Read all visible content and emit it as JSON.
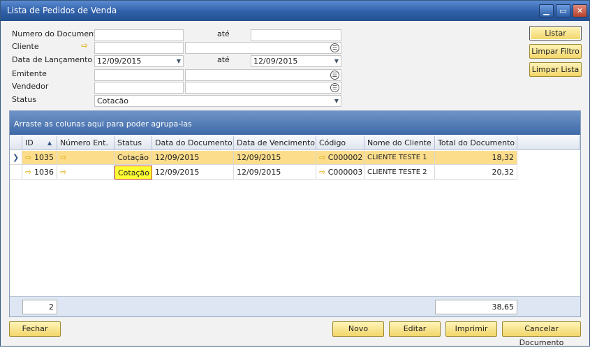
{
  "window": {
    "title": "Lista de Pedidos de Venda"
  },
  "filters": {
    "numero_label": "Numero do Documento",
    "ate_label": "até",
    "cliente_label": "Cliente",
    "data_label": "Data de Lançamento",
    "data_from": "12/09/2015",
    "data_to": "12/09/2015",
    "emitente_label": "Emitente",
    "vendedor_label": "Vendedor",
    "status_label": "Status",
    "status_value": "Cotacão"
  },
  "side_buttons": {
    "listar": "Listar",
    "limpar_filtro": "Limpar Filtro",
    "limpar_lista": "Limpar Lista"
  },
  "grid": {
    "group_hint": "Arraste as colunas aqui para poder agrupa-las",
    "columns": [
      "ID",
      "Número Ent.",
      "Status",
      "Data do Documento",
      "Data de Vencimento",
      "Código",
      "Nome do Cliente",
      "Total do Documento"
    ],
    "rows": [
      {
        "id": "1035",
        "status": "Cotação",
        "data_doc": "12/09/2015",
        "data_venc": "12/09/2015",
        "codigo": "C000002",
        "cliente": "CLIENTE TESTE 1",
        "total": "18,32"
      },
      {
        "id": "1036",
        "status": "Cotação",
        "data_doc": "12/09/2015",
        "data_venc": "12/09/2015",
        "codigo": "C000003",
        "cliente": "CLIENTE TESTE 2",
        "total": "20,32"
      }
    ],
    "footer_count": "2",
    "footer_total": "38,65"
  },
  "buttons": {
    "fechar": "Fechar",
    "novo": "Novo",
    "editar": "Editar",
    "imprimir": "Imprimir",
    "cancelar": "Cancelar Documento"
  },
  "icons": {
    "link_arrow": "link-arrow-icon",
    "choose_from_list": "choose-from-list-icon",
    "dropdown": "chevron-down-icon",
    "sort": "sort-asc-icon",
    "row_selector": "row-selector-icon"
  }
}
